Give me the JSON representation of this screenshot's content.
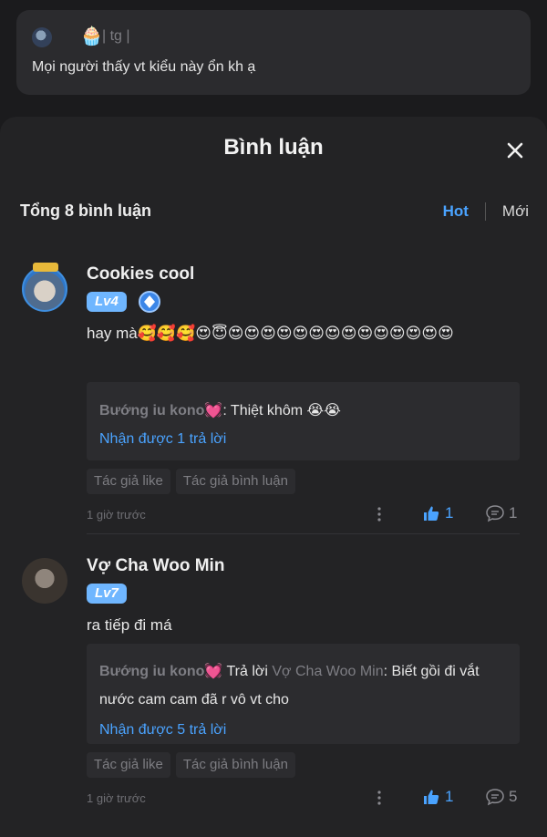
{
  "post": {
    "badge_emoji": "🧁",
    "meta": "| tg |",
    "text": "Mọi người thấy vt kiểu này ổn kh ạ"
  },
  "sheet": {
    "title": "Bình luận",
    "count_label": "Tổng 8 bình luận",
    "sort_hot": "Hot",
    "sort_new": "Mới"
  },
  "comments": [
    {
      "name": "Cookies cool",
      "level": "Lv4",
      "text": "hay mà🥰🥰🥰😍😇😍😍😍😍😍😍😍😍😍😍😍😍😍😍",
      "reply": {
        "author": "Bướng iu kono💓",
        "prefix": "",
        "target": "",
        "text": ": Thiệt khôm 😭😭",
        "more": "Nhận được 1 trả lời"
      },
      "tags": [
        "Tác giả like",
        "Tác giả bình luận"
      ],
      "time": "1 giờ trước",
      "likes": "1",
      "replies": "1"
    },
    {
      "name": "Vợ Cha Woo Min",
      "level": "Lv7",
      "text": "ra tiếp đi má",
      "reply": {
        "author": "Bướng iu kono💓",
        "prefix": " Trả lời ",
        "target": "Vợ Cha Woo Min",
        "text": ": Biết gồi đi vắt nước cam cam đã r vô vt cho",
        "more": "Nhận được 5 trả lời"
      },
      "tags": [
        "Tác giả like",
        "Tác giả bình luận"
      ],
      "time": "1 giờ trước",
      "likes": "1",
      "replies": "5"
    }
  ],
  "icons": {
    "close": "close-icon",
    "like": "thumbs-up-icon",
    "reply": "comment-bubble-icon",
    "more": "more-vertical-icon",
    "badge": "shield-badge-icon"
  },
  "colors": {
    "accent": "#4aa3ff",
    "level_badge": "#6fb6ff"
  }
}
